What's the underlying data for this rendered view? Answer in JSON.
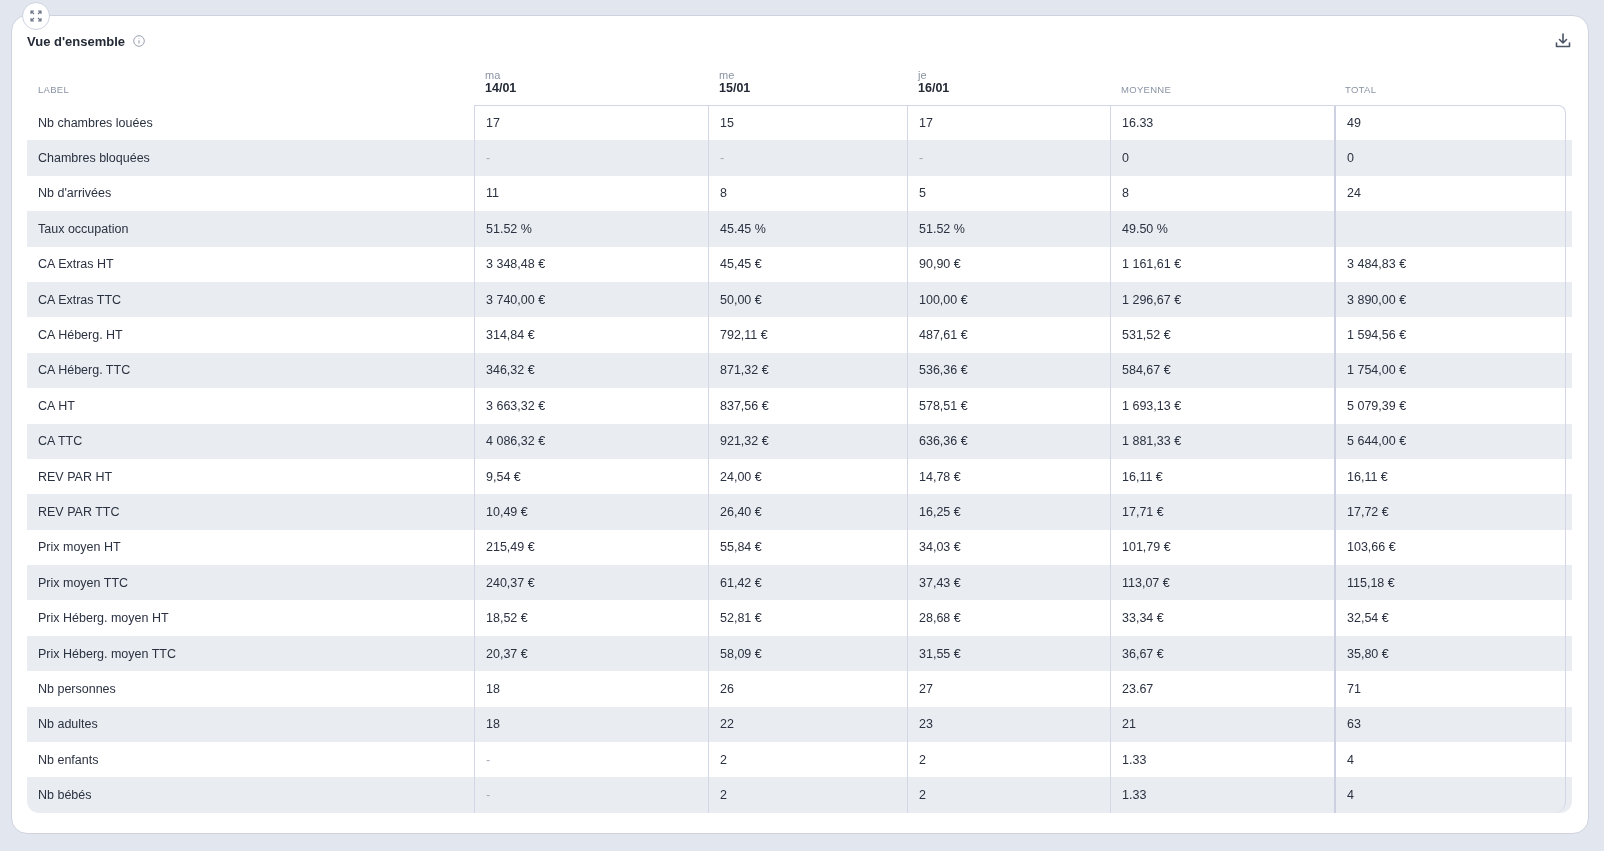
{
  "card": {
    "title": "Vue d'ensemble"
  },
  "table": {
    "columns": [
      {
        "kind": "label",
        "name": "LABEL"
      },
      {
        "kind": "day",
        "day": "ma",
        "date": "14/01"
      },
      {
        "kind": "day",
        "day": "me",
        "date": "15/01"
      },
      {
        "kind": "day",
        "day": "je",
        "date": "16/01"
      },
      {
        "kind": "label",
        "name": "MOYENNE"
      },
      {
        "kind": "label",
        "name": "TOTAL"
      }
    ],
    "rows": [
      {
        "cells": [
          {
            "value": "Nb chambres louées"
          },
          {
            "value": "17",
            "empty": false
          },
          {
            "value": "15",
            "empty": false
          },
          {
            "value": "17",
            "empty": false
          },
          {
            "value": "16.33",
            "empty": false
          },
          {
            "value": "49",
            "empty": false
          }
        ]
      },
      {
        "cells": [
          {
            "value": "Chambres bloquées"
          },
          {
            "value": "-",
            "empty": true
          },
          {
            "value": "-",
            "empty": true
          },
          {
            "value": "-",
            "empty": true
          },
          {
            "value": "0",
            "empty": false
          },
          {
            "value": "0",
            "empty": false
          }
        ]
      },
      {
        "cells": [
          {
            "value": "Nb d'arrivées"
          },
          {
            "value": "11",
            "empty": false
          },
          {
            "value": "8",
            "empty": false
          },
          {
            "value": "5",
            "empty": false
          },
          {
            "value": "8",
            "empty": false
          },
          {
            "value": "24",
            "empty": false
          }
        ]
      },
      {
        "cells": [
          {
            "value": "Taux occupation"
          },
          {
            "value": "51.52 %",
            "empty": false
          },
          {
            "value": "45.45 %",
            "empty": false
          },
          {
            "value": "51.52 %",
            "empty": false
          },
          {
            "value": "49.50 %",
            "empty": false
          }
        ]
      },
      {
        "cells": [
          {
            "value": "CA Extras HT"
          },
          {
            "value": "3 348,48 €",
            "empty": false
          },
          {
            "value": "45,45 €",
            "empty": false
          },
          {
            "value": "90,90 €",
            "empty": false
          },
          {
            "value": "1 161,61 €",
            "empty": false
          },
          {
            "value": "3 484,83 €",
            "empty": false
          }
        ]
      },
      {
        "cells": [
          {
            "value": "CA Extras TTC"
          },
          {
            "value": "3 740,00 €",
            "empty": false
          },
          {
            "value": "50,00 €",
            "empty": false
          },
          {
            "value": "100,00 €",
            "empty": false
          },
          {
            "value": "1 296,67 €",
            "empty": false
          },
          {
            "value": "3 890,00 €",
            "empty": false
          }
        ]
      },
      {
        "cells": [
          {
            "value": "CA Héberg. HT"
          },
          {
            "value": "314,84 €",
            "empty": false
          },
          {
            "value": "792,11 €",
            "empty": false
          },
          {
            "value": "487,61 €",
            "empty": false
          },
          {
            "value": "531,52 €",
            "empty": false
          },
          {
            "value": "1 594,56 €",
            "empty": false
          }
        ]
      },
      {
        "cells": [
          {
            "value": "CA Héberg. TTC"
          },
          {
            "value": "346,32 €",
            "empty": false
          },
          {
            "value": "871,32 €",
            "empty": false
          },
          {
            "value": "536,36 €",
            "empty": false
          },
          {
            "value": "584,67 €",
            "empty": false
          },
          {
            "value": "1 754,00 €",
            "empty": false
          }
        ]
      },
      {
        "cells": [
          {
            "value": "CA HT"
          },
          {
            "value": "3 663,32 €",
            "empty": false
          },
          {
            "value": "837,56 €",
            "empty": false
          },
          {
            "value": "578,51 €",
            "empty": false
          },
          {
            "value": "1 693,13 €",
            "empty": false
          },
          {
            "value": "5 079,39 €",
            "empty": false
          }
        ]
      },
      {
        "cells": [
          {
            "value": "CA TTC"
          },
          {
            "value": "4 086,32 €",
            "empty": false
          },
          {
            "value": "921,32 €",
            "empty": false
          },
          {
            "value": "636,36 €",
            "empty": false
          },
          {
            "value": "1 881,33 €",
            "empty": false
          },
          {
            "value": "5 644,00 €",
            "empty": false
          }
        ]
      },
      {
        "cells": [
          {
            "value": "REV PAR HT"
          },
          {
            "value": "9,54 €",
            "empty": false
          },
          {
            "value": "24,00 €",
            "empty": false
          },
          {
            "value": "14,78 €",
            "empty": false
          },
          {
            "value": "16,11 €",
            "empty": false
          },
          {
            "value": "16,11 €",
            "empty": false
          }
        ]
      },
      {
        "cells": [
          {
            "value": "REV PAR TTC"
          },
          {
            "value": "10,49 €",
            "empty": false
          },
          {
            "value": "26,40 €",
            "empty": false
          },
          {
            "value": "16,25 €",
            "empty": false
          },
          {
            "value": "17,71 €",
            "empty": false
          },
          {
            "value": "17,72 €",
            "empty": false
          }
        ]
      },
      {
        "cells": [
          {
            "value": "Prix moyen HT"
          },
          {
            "value": "215,49 €",
            "empty": false
          },
          {
            "value": "55,84 €",
            "empty": false
          },
          {
            "value": "34,03 €",
            "empty": false
          },
          {
            "value": "101,79 €",
            "empty": false
          },
          {
            "value": "103,66 €",
            "empty": false
          }
        ]
      },
      {
        "cells": [
          {
            "value": "Prix moyen TTC"
          },
          {
            "value": "240,37 €",
            "empty": false
          },
          {
            "value": "61,42 €",
            "empty": false
          },
          {
            "value": "37,43 €",
            "empty": false
          },
          {
            "value": "113,07 €",
            "empty": false
          },
          {
            "value": "115,18 €",
            "empty": false
          }
        ]
      },
      {
        "cells": [
          {
            "value": "Prix Héberg. moyen HT"
          },
          {
            "value": "18,52 €",
            "empty": false
          },
          {
            "value": "52,81 €",
            "empty": false
          },
          {
            "value": "28,68 €",
            "empty": false
          },
          {
            "value": "33,34 €",
            "empty": false
          },
          {
            "value": "32,54 €",
            "empty": false
          }
        ]
      },
      {
        "cells": [
          {
            "value": "Prix Héberg. moyen TTC"
          },
          {
            "value": "20,37 €",
            "empty": false
          },
          {
            "value": "58,09 €",
            "empty": false
          },
          {
            "value": "31,55 €",
            "empty": false
          },
          {
            "value": "36,67 €",
            "empty": false
          },
          {
            "value": "35,80 €",
            "empty": false
          }
        ]
      },
      {
        "cells": [
          {
            "value": "Nb personnes"
          },
          {
            "value": "18",
            "empty": false
          },
          {
            "value": "26",
            "empty": false
          },
          {
            "value": "27",
            "empty": false
          },
          {
            "value": "23.67",
            "empty": false
          },
          {
            "value": "71",
            "empty": false
          }
        ]
      },
      {
        "cells": [
          {
            "value": "Nb adultes"
          },
          {
            "value": "18",
            "empty": false
          },
          {
            "value": "22",
            "empty": false
          },
          {
            "value": "23",
            "empty": false
          },
          {
            "value": "21",
            "empty": false
          },
          {
            "value": "63",
            "empty": false
          }
        ]
      },
      {
        "cells": [
          {
            "value": "Nb enfants"
          },
          {
            "value": "-",
            "empty": true
          },
          {
            "value": "2",
            "empty": false
          },
          {
            "value": "2",
            "empty": false
          },
          {
            "value": "1.33",
            "empty": false
          },
          {
            "value": "4",
            "empty": false
          }
        ]
      },
      {
        "cells": [
          {
            "value": "Nb bébés"
          },
          {
            "value": "-",
            "empty": true
          },
          {
            "value": "2",
            "empty": false
          },
          {
            "value": "2",
            "empty": false
          },
          {
            "value": "1.33",
            "empty": false
          },
          {
            "value": "4",
            "empty": false
          }
        ]
      }
    ]
  }
}
